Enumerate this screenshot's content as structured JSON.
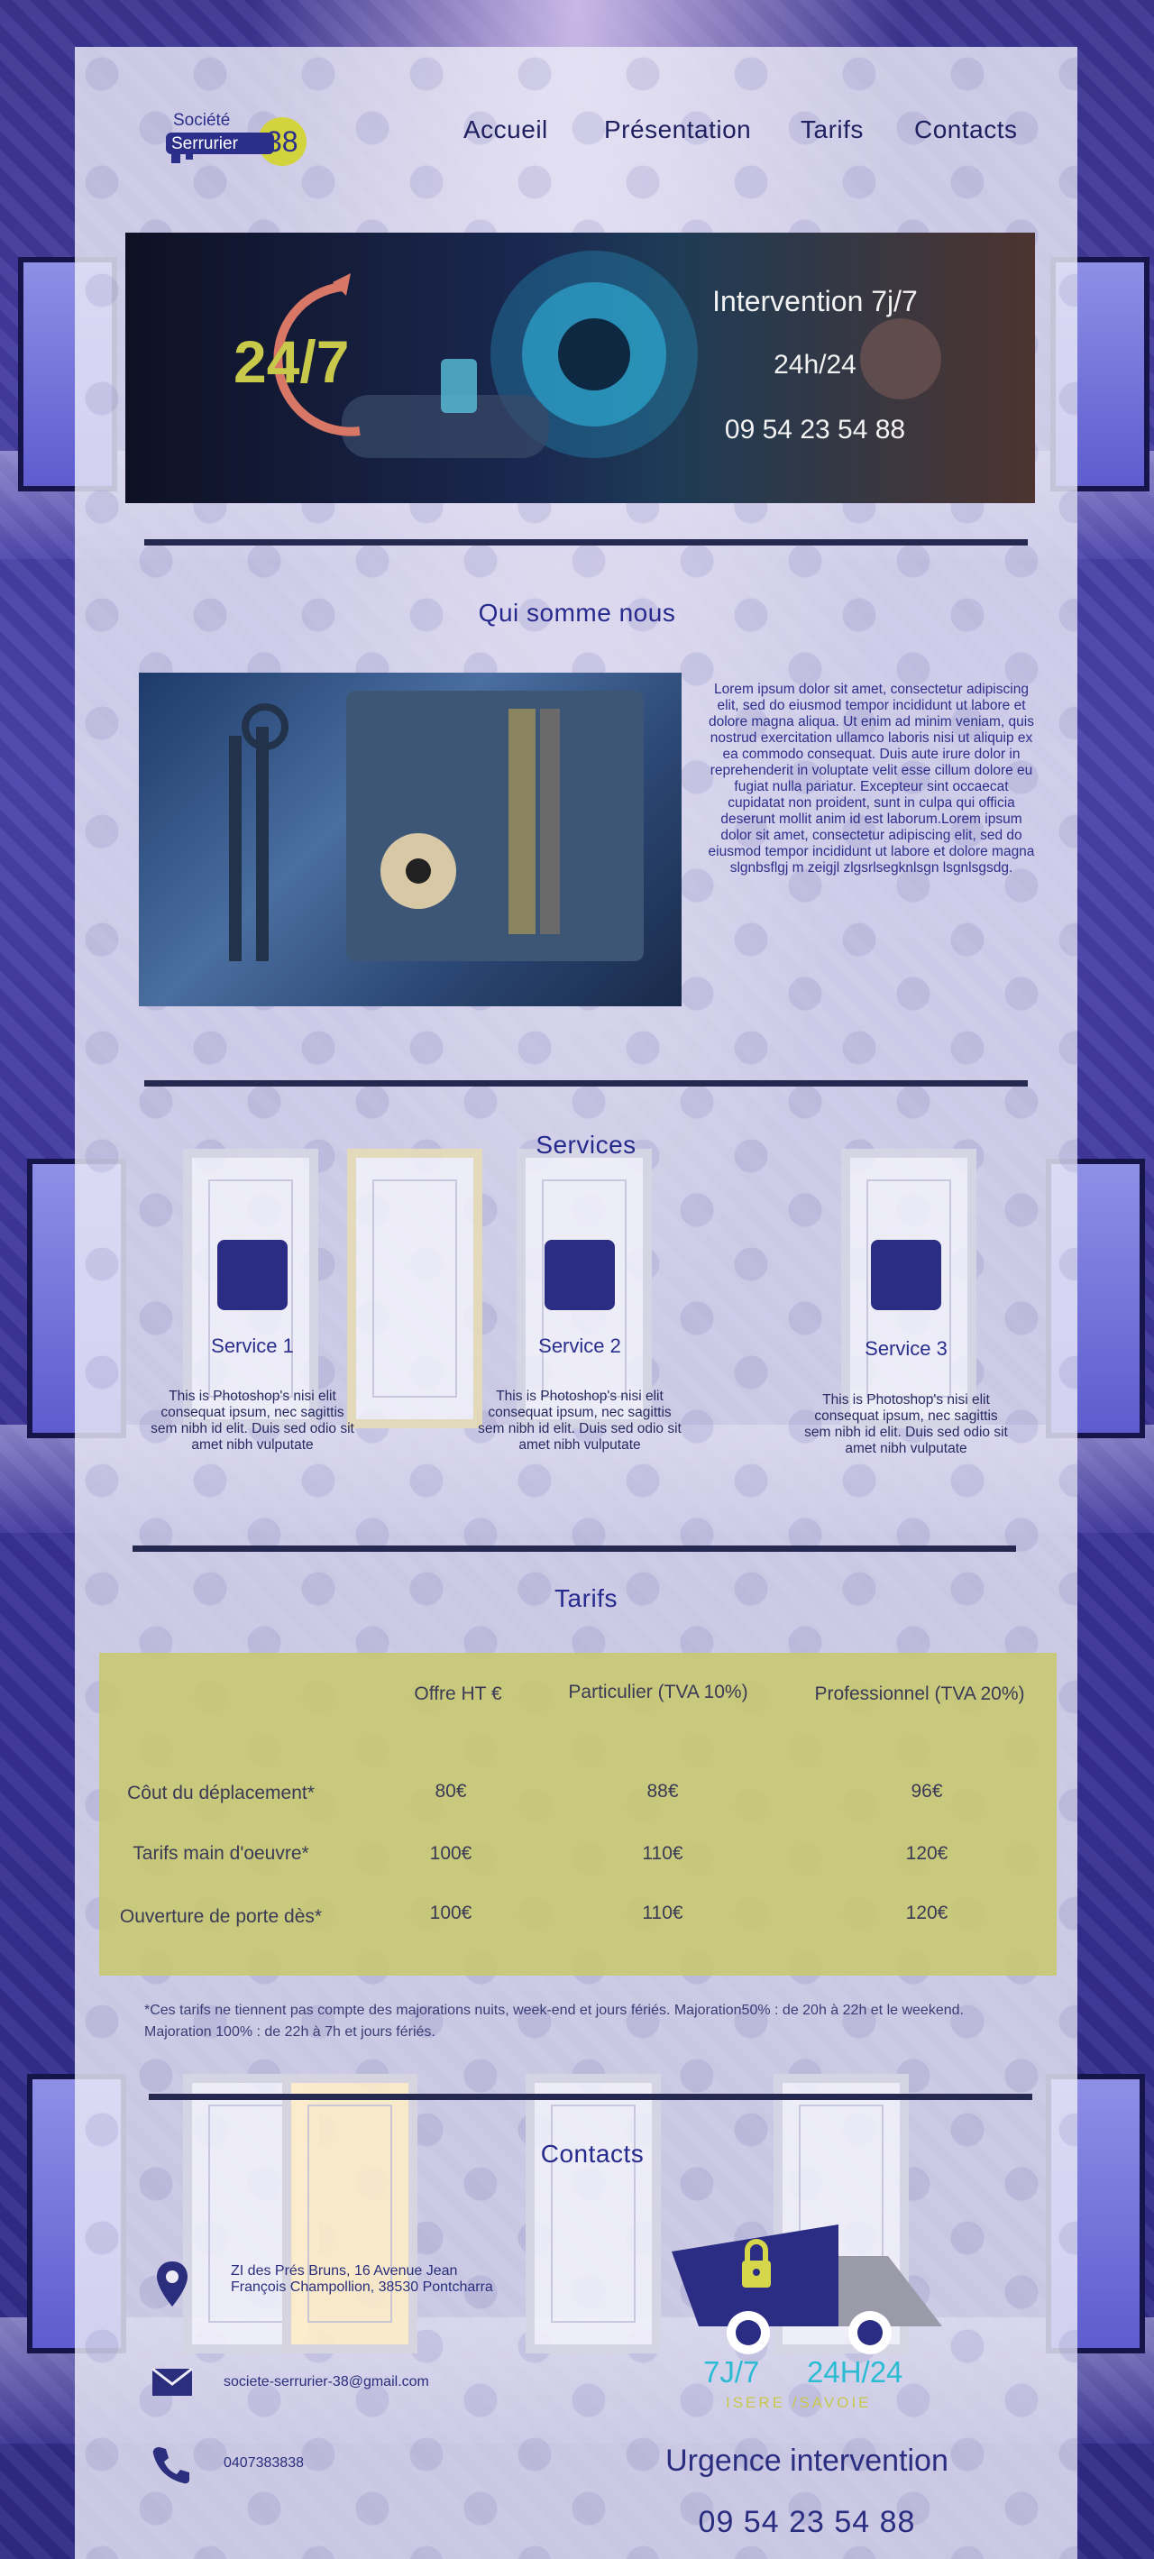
{
  "brand": {
    "line1": "Société",
    "line2": "Serrurier",
    "number": "38"
  },
  "nav": [
    {
      "label": "Accueil"
    },
    {
      "label": "Présentation"
    },
    {
      "label": "Tarifs"
    },
    {
      "label": "Contacts"
    }
  ],
  "banner": {
    "badge": "24/7",
    "line1": "Intervention 7j/7",
    "line2": "24h/24",
    "phone": "09 54 23 54 88"
  },
  "about": {
    "title": "Qui somme nous",
    "text": "Lorem ipsum dolor sit amet, consectetur adipiscing elit, sed do eiusmod tempor incididunt ut labore et dolore magna aliqua. Ut enim ad minim veniam, quis nostrud exercitation ullamco laboris nisi ut aliquip ex ea commodo consequat. Duis aute irure dolor in reprehenderit in voluptate velit esse cillum dolore eu fugiat nulla pariatur. Excepteur sint occaecat cupidatat non proident, sunt in culpa qui officia deserunt mollit anim id est laborum.Lorem ipsum dolor sit amet, consectetur adipiscing elit, sed do eiusmod tempor incididunt ut labore et dolore magna slgnbsflgj m zeigjl zlgsrlsegknlsgn lsgnlsgsdg."
  },
  "services": {
    "title": "Services",
    "items": [
      {
        "title": "Service 1",
        "text": "This is Photoshop's nisi elit consequat ipsum, nec sagittis sem nibh id elit. Duis sed odio sit amet nibh vulputate"
      },
      {
        "title": "Service 2",
        "text": "This is Photoshop's nisi elit consequat ipsum, nec sagittis sem nibh id elit. Duis sed odio sit amet nibh vulputate"
      },
      {
        "title": "Service 3",
        "text": "This is Photoshop's nisi elit consequat ipsum, nec sagittis sem nibh id elit. Duis sed odio sit amet nibh vulputate"
      }
    ]
  },
  "tarifs": {
    "title": "Tarifs",
    "headers": [
      "Offre HT €",
      "Particulier (TVA 10%)",
      "Professionnel (TVA 20%)"
    ],
    "rows": [
      {
        "label": "Côut du déplacement*",
        "values": [
          "80€",
          "88€",
          "96€"
        ]
      },
      {
        "label": "Tarifs main d'oeuvre*",
        "values": [
          "100€",
          "110€",
          "120€"
        ]
      },
      {
        "label": "Ouverture de porte dès*",
        "values": [
          "100€",
          "110€",
          "120€"
        ]
      }
    ],
    "note": "*Ces tarifs ne tiennent pas compte des majorations nuits, week-end et jours fériés. Majoration50% : de 20h à 22h et le weekend. Majoration 100% : de 22h à 7h et jours fériés."
  },
  "contacts": {
    "title": "Contacts",
    "address": "ZI des Prés Bruns, 16  Avenue Jean François Champollion, 38530 Pontcharra",
    "email": "societe-serrurier-38@gmail.com",
    "phone": "0407383838",
    "truck": {
      "left": "7J/7",
      "right": "24H/24",
      "sub": "ISERE /SAVOIE"
    },
    "urgence": "Urgence intervention",
    "urgence_phone": "09 54 23 54 88"
  },
  "colors": {
    "navy": "#262a8c",
    "olive": "#c8c86e",
    "yellow": "#d6d64a",
    "cyan": "#2bbcd4"
  }
}
